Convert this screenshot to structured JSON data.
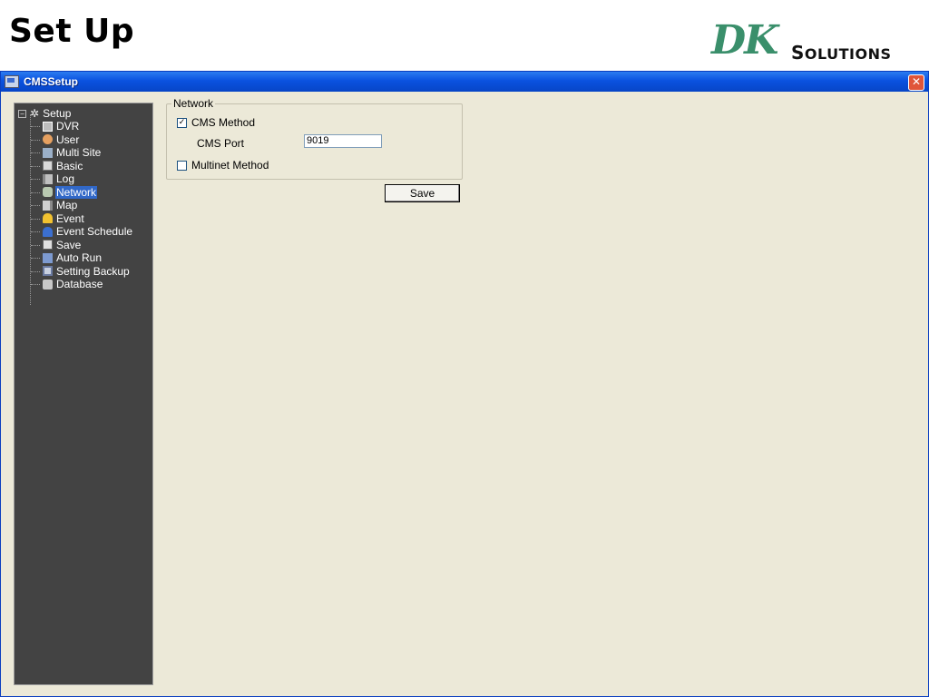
{
  "slide": {
    "title": "Set Up"
  },
  "logo": {
    "mark": "DK",
    "text_first": "S",
    "text_rest": "OLUTIONS"
  },
  "window": {
    "title": "CMSSetup",
    "close_glyph": "✕"
  },
  "tree": {
    "root": {
      "label": "Setup",
      "toggle": "−"
    },
    "items": [
      {
        "label": "DVR",
        "icon": "dvr-icon"
      },
      {
        "label": "User",
        "icon": "user-icon"
      },
      {
        "label": "Multi Site",
        "icon": "multi-site-icon"
      },
      {
        "label": "Basic",
        "icon": "basic-icon"
      },
      {
        "label": "Log",
        "icon": "log-icon"
      },
      {
        "label": "Network",
        "icon": "network-icon",
        "selected": true
      },
      {
        "label": "Map",
        "icon": "map-icon"
      },
      {
        "label": "Event",
        "icon": "event-bell-icon"
      },
      {
        "label": "Event Schedule",
        "icon": "event-schedule-icon"
      },
      {
        "label": "Save",
        "icon": "save-icon"
      },
      {
        "label": "Auto Run",
        "icon": "auto-run-icon"
      },
      {
        "label": "Setting Backup",
        "icon": "setting-backup-icon"
      },
      {
        "label": "Database",
        "icon": "database-icon"
      }
    ]
  },
  "network": {
    "group_label": "Network",
    "cms_method": {
      "label": "CMS Method",
      "checked": true,
      "mark": "✓"
    },
    "cms_port": {
      "label": "CMS Port",
      "value": "9019"
    },
    "multinet_method": {
      "label": "Multinet Method",
      "checked": false,
      "mark": ""
    },
    "save_label": "Save"
  },
  "colors": {
    "title_bar": "#0a52e0",
    "tree_bg": "#434343",
    "selection": "#3168c8",
    "window_bg": "#ece9d8",
    "logo_green": "#3a8f6b"
  }
}
